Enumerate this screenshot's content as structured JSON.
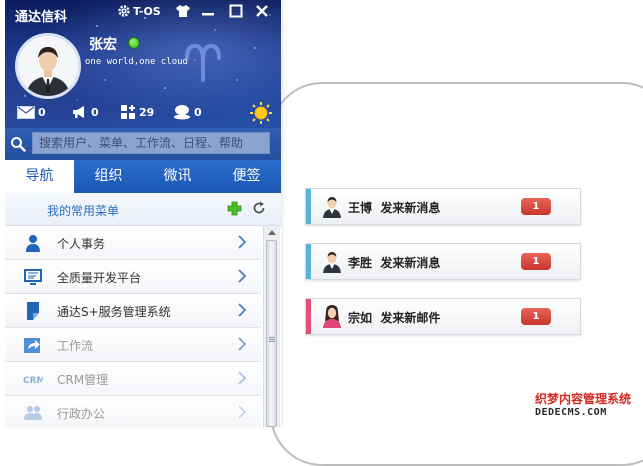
{
  "app": {
    "title": "通达信科"
  },
  "topbar": {
    "tos_label": "T-OS"
  },
  "profile": {
    "name": "张宏",
    "status": "online",
    "motto": "one world,one cloud"
  },
  "stats": {
    "mail": "0",
    "notices": "0",
    "apps": "29",
    "chat": "0"
  },
  "search": {
    "placeholder": "搜索用户、菜单、工作流、日程、帮助"
  },
  "tabs": [
    {
      "label": "导航",
      "active": true
    },
    {
      "label": "组织",
      "active": false
    },
    {
      "label": "微讯",
      "active": false
    },
    {
      "label": "便签",
      "active": false
    }
  ],
  "favorites": {
    "label": "我的常用菜单"
  },
  "menu": [
    {
      "label": "个人事务",
      "icon": "person-icon"
    },
    {
      "label": "全质量开发平台",
      "icon": "monitor-icon"
    },
    {
      "label": "通达S+服务管理系统",
      "icon": "document-icon"
    },
    {
      "label": "工作流",
      "icon": "workflow-icon"
    },
    {
      "label": "CRM管理",
      "icon": "crm-icon"
    },
    {
      "label": "行政办公",
      "icon": "people-icon"
    }
  ],
  "notifications": [
    {
      "sender": "王博",
      "action": "发来新消息",
      "count": "1",
      "accent": "#5bb2dd"
    },
    {
      "sender": "李胜",
      "action": "发来新消息",
      "count": "1",
      "accent": "#5bb2dd"
    },
    {
      "sender": "宗如",
      "action": "发来新邮件",
      "count": "1",
      "accent": "#e3507a"
    }
  ],
  "watermark": {
    "line1": "织梦内容管理系统",
    "line2": "DEDECMS.COM"
  },
  "colors": {
    "header": "#1b3a8f",
    "tab_bar": "#2a6ccc",
    "badge": "#d8453a",
    "link": "#2a6cc2"
  }
}
